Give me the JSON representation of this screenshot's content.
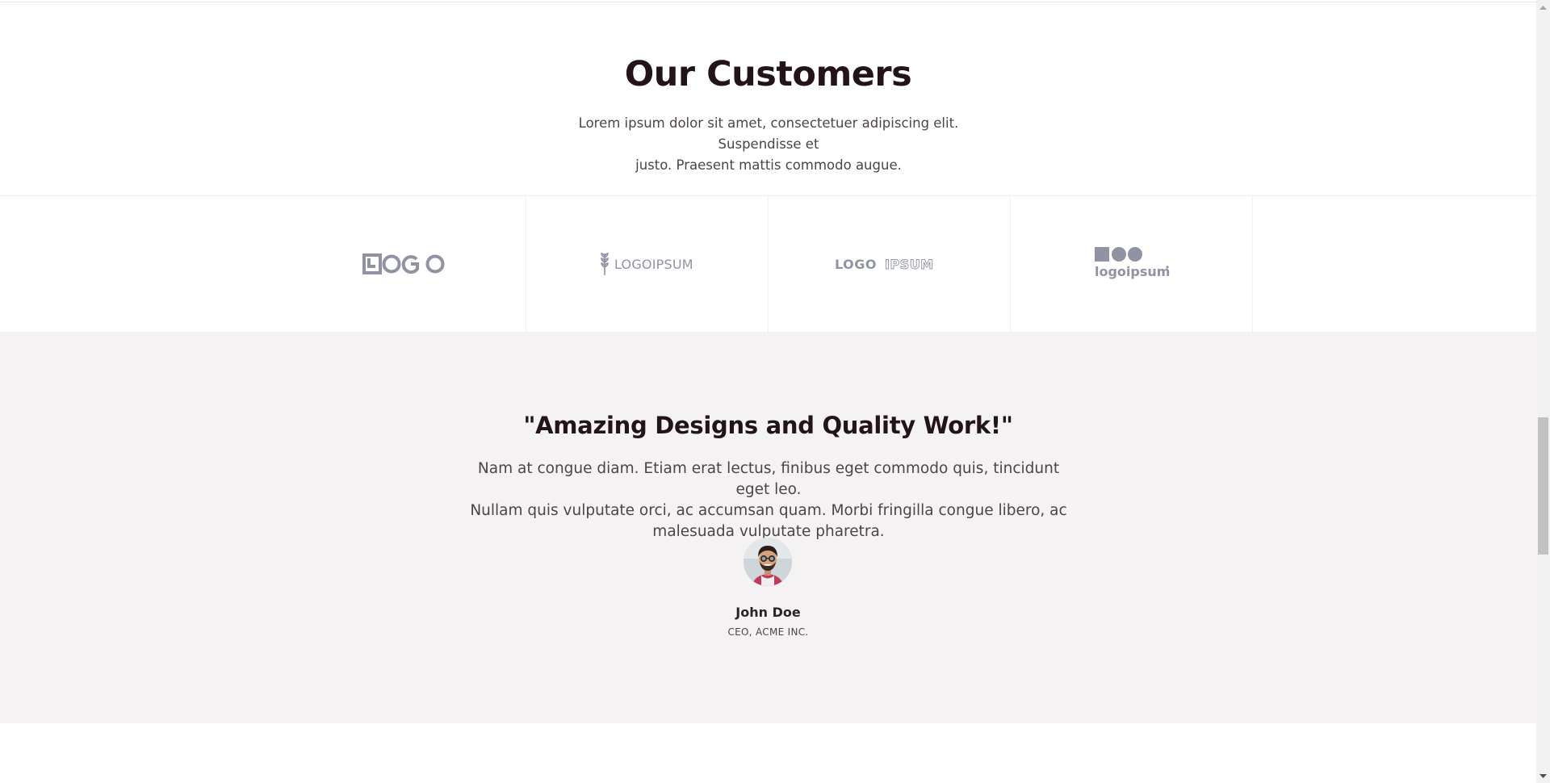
{
  "customers": {
    "title": "Our Customers",
    "lead_line1": "Lorem ipsum dolor sit amet, consectetuer adipiscing elit. Suspendisse et",
    "lead_line2": "justo. Praesent mattis commodo augue."
  },
  "logos": [
    {
      "name": "LOGO",
      "icon": "logo-wordmark"
    },
    {
      "name": "LOGOIPSUM",
      "icon": "wheat-logo"
    },
    {
      "name": "LOGOIPSUM",
      "icon": "bold-outline-logo"
    },
    {
      "name": "logoipsum",
      "icon": "shapes-logo"
    }
  ],
  "testimonial": {
    "heading": "\"Amazing Designs and Quality Work!\"",
    "quote_line1": "Nam at congue diam. Etiam erat lectus, finibus eget commodo quis, tincidunt eget leo.",
    "quote_line2": "Nullam quis vulputate orci, ac accumsan quam. Morbi fringilla congue libero, ac",
    "quote_line3": "malesuada vulputate pharetra.",
    "author_name": "John Doe",
    "author_role": "CEO, ACME INC."
  },
  "colors": {
    "heading": "#231517",
    "body_text": "#4c4448",
    "logo_gray": "#8f93a3",
    "testimonial_bg": "#f5f2f3"
  },
  "scrollbar": {
    "up_icon": "chevron-up-icon",
    "down_icon": "chevron-down-icon"
  }
}
